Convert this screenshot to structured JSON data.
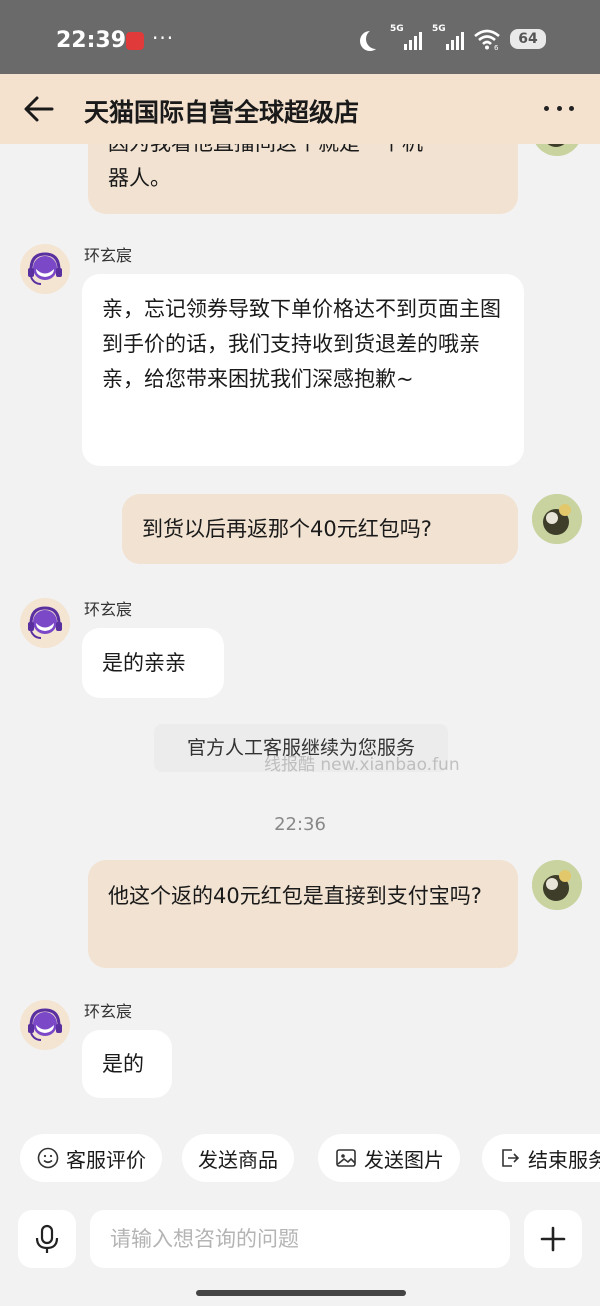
{
  "status_bar": {
    "time": "22:39",
    "dots": "···",
    "sim1_label": "5G",
    "sim2_label": "5G",
    "wifi_badge": "6",
    "battery": "64"
  },
  "header": {
    "title": "天猫国际自营全球超级店"
  },
  "messages": {
    "partial_out_line1": "因为我看他直播间这个就是一个机",
    "partial_out_line2": "器人。",
    "agent_name": "环玄宸",
    "agent_msg_1": "亲，忘记领券导致下单价格达不到页面主图到手价的话，我们支持收到货退差的哦亲亲，给您带来困扰我们深感抱歉~",
    "user_msg_1": "到货以后再返那个40元红包吗?",
    "agent_msg_2": "是的亲亲",
    "system_note": "官方人工客服继续为您服务",
    "watermark": "线报酷 new.xianbao.fun",
    "time_separator": "22:36",
    "user_msg_2": "他这个返的40元红包是直接到支付宝吗?",
    "agent_msg_3": "是的"
  },
  "quick_actions": {
    "rate_service": "客服评价",
    "send_product": "发送商品",
    "send_image": "发送图片",
    "end_service": "结束服务"
  },
  "input": {
    "placeholder": "请输入想咨询的问题"
  },
  "colors": {
    "header_bg": "#f4e2cf",
    "user_bubble": "#f1e2d1",
    "agent_bubble": "#ffffff",
    "agent_avatar_accent": "#7b48c7"
  }
}
